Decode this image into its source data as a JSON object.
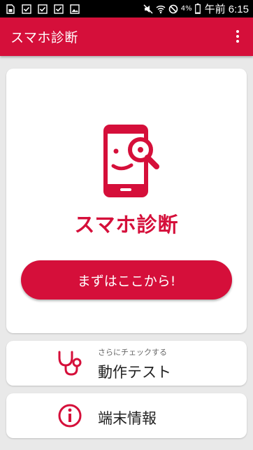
{
  "status_bar": {
    "left_icons": [
      "sim-icon",
      "checkbox-icon",
      "checkbox-icon",
      "checkbox-icon",
      "image-icon"
    ],
    "right_icons": [
      "mute-icon",
      "wifi-icon",
      "no-sign-icon",
      "battery-icon"
    ],
    "battery": "4%",
    "time": "午前 6:15"
  },
  "app_bar": {
    "title": "スマホ診断",
    "menu_icon": "overflow-menu-icon"
  },
  "main_card": {
    "logo_icon": "phone-magnifier-icon",
    "title": "スマホ診断",
    "start_button": "まずはここから!"
  },
  "menu": [
    {
      "icon": "stethoscope-icon",
      "sub": "さらにチェックする",
      "label": "動作テスト"
    },
    {
      "icon": "info-icon",
      "label": "端末情報"
    }
  ],
  "colors": {
    "accent": "#d50f3a",
    "background": "#e9e9e9",
    "card": "#ffffff"
  }
}
